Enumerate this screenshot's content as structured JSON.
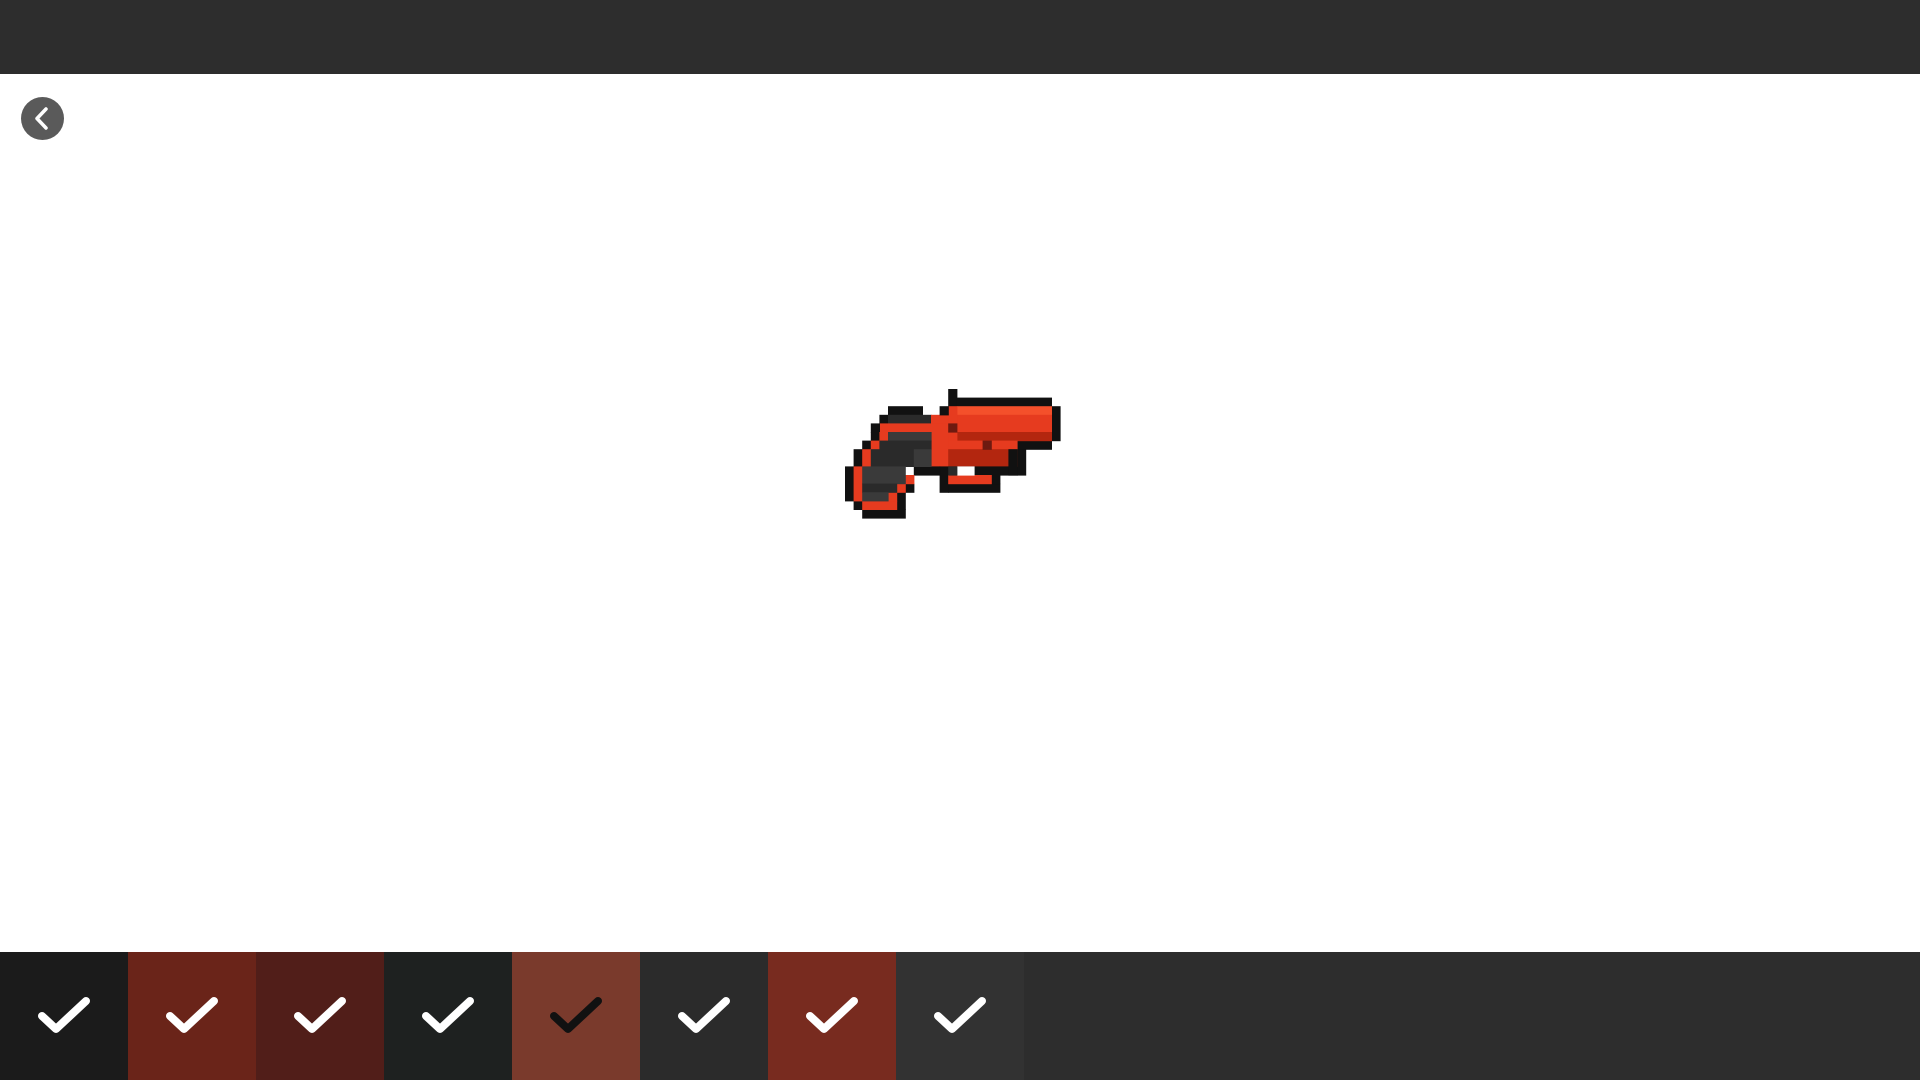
{
  "header": {
    "back_icon": "chevron-left-icon"
  },
  "sprite": {
    "subject": "flare-gun-pixel-art",
    "colors": {
      "outline": "#111111",
      "red_main": "#e63b1f",
      "red_light": "#f4502b",
      "red_dark": "#b3260f",
      "red_deep": "#6e1a10",
      "grip_dark": "#2a2a2a",
      "grip_mid": "#3a3a3a",
      "white": "#ffffff"
    }
  },
  "palette": {
    "swatches": [
      {
        "color": "#1b1b1b",
        "check_color": "#ffffff",
        "checked": true
      },
      {
        "color": "#6a2419",
        "check_color": "#ffffff",
        "checked": true
      },
      {
        "color": "#511e19",
        "check_color": "#ffffff",
        "checked": true
      },
      {
        "color": "#1e2120",
        "check_color": "#ffffff",
        "checked": true
      },
      {
        "color": "#7a3a2c",
        "check_color": "#111111",
        "checked": true
      },
      {
        "color": "#2b2b2b",
        "check_color": "#ffffff",
        "checked": true
      },
      {
        "color": "#782b1f",
        "check_color": "#ffffff",
        "checked": true
      },
      {
        "color": "#323232",
        "check_color": "#ffffff",
        "checked": true
      }
    ],
    "check_icon": "checkmark-icon"
  }
}
